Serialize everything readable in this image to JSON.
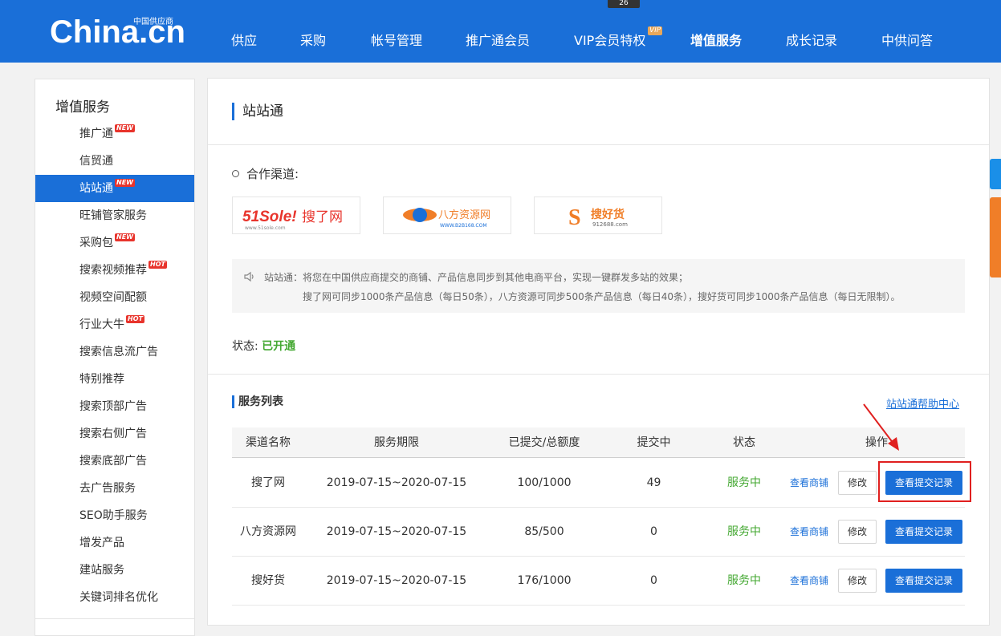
{
  "header": {
    "logo_main": "China.cn",
    "logo_sub": "中国供应商",
    "tip_badge": "26",
    "nav": [
      {
        "label": "供应"
      },
      {
        "label": "采购"
      },
      {
        "label": "帐号管理"
      },
      {
        "label": "推广通会员"
      },
      {
        "label": "VIP会员特权",
        "badge": "VIP"
      },
      {
        "label": "增值服务",
        "active": true
      },
      {
        "label": "成长记录"
      },
      {
        "label": "中供问答"
      }
    ]
  },
  "sidebar": {
    "title": "增值服务",
    "items": [
      {
        "label": "推广通",
        "tag": "NEW"
      },
      {
        "label": "信贸通"
      },
      {
        "label": "站站通",
        "tag": "NEW",
        "active": true
      },
      {
        "label": "旺铺管家服务"
      },
      {
        "label": "采购包",
        "tag": "NEW"
      },
      {
        "label": "搜索视频推荐",
        "tag": "HOT"
      },
      {
        "label": "视频空间配额"
      },
      {
        "label": "行业大牛",
        "tag": "HOT"
      },
      {
        "label": "搜索信息流广告"
      },
      {
        "label": "特别推荐"
      },
      {
        "label": "搜索顶部广告"
      },
      {
        "label": "搜索右侧广告"
      },
      {
        "label": "搜索底部广告"
      },
      {
        "label": "去广告服务"
      },
      {
        "label": "SEO助手服务"
      },
      {
        "label": "增发产品"
      },
      {
        "label": "建站服务"
      },
      {
        "label": "关键词排名优化"
      }
    ]
  },
  "main": {
    "title": "站站通",
    "channel_label": "合作渠道:",
    "partners": [
      {
        "name": "51sole 搜了网",
        "text_main": "51Sole!",
        "text_cn": "搜了网",
        "url": "www.51sole.com"
      },
      {
        "name": "八方资源网",
        "text_cn": "八方资源网",
        "url": "WWW.B2B168.COM"
      },
      {
        "name": "搜好货",
        "text_cn": "搜好货",
        "url": "912688.com"
      }
    ],
    "notice_line1": "站站通：将您在中国供应商提交的商铺、产品信息同步到其他电商平台，实现一键群发多站的效果；",
    "notice_line2": "搜了网可同步1000条产品信息（每日50条），八方资源可同步500条产品信息（每日40条），搜好货可同步1000条产品信息（每日无限制）。",
    "status_label": "状态:",
    "status_value": "已开通",
    "list_title": "服务列表",
    "help_link": "站站通帮助中心",
    "table": {
      "headers": [
        "渠道名称",
        "服务期限",
        "已提交/总额度",
        "提交中",
        "状态",
        "操作"
      ],
      "rows": [
        {
          "channel": "搜了网",
          "period": "2019-07-15~2020-07-15",
          "quota": "100/1000",
          "pending": "49",
          "status": "服务中",
          "shop_link": "查看商铺",
          "edit": "修改",
          "view": "查看提交记录"
        },
        {
          "channel": "八方资源网",
          "period": "2019-07-15~2020-07-15",
          "quota": "85/500",
          "pending": "0",
          "status": "服务中",
          "shop_link": "查看商铺",
          "edit": "修改",
          "view": "查看提交记录"
        },
        {
          "channel": "搜好货",
          "period": "2019-07-15~2020-07-15",
          "quota": "176/1000",
          "pending": "0",
          "status": "服务中",
          "shop_link": "查看商铺",
          "edit": "修改",
          "view": "查看提交记录"
        }
      ]
    }
  },
  "colors": {
    "brand": "#1a6fd8",
    "status_ok": "#44a832",
    "tag_red": "#e8342c",
    "annotation": "#e0201f"
  }
}
